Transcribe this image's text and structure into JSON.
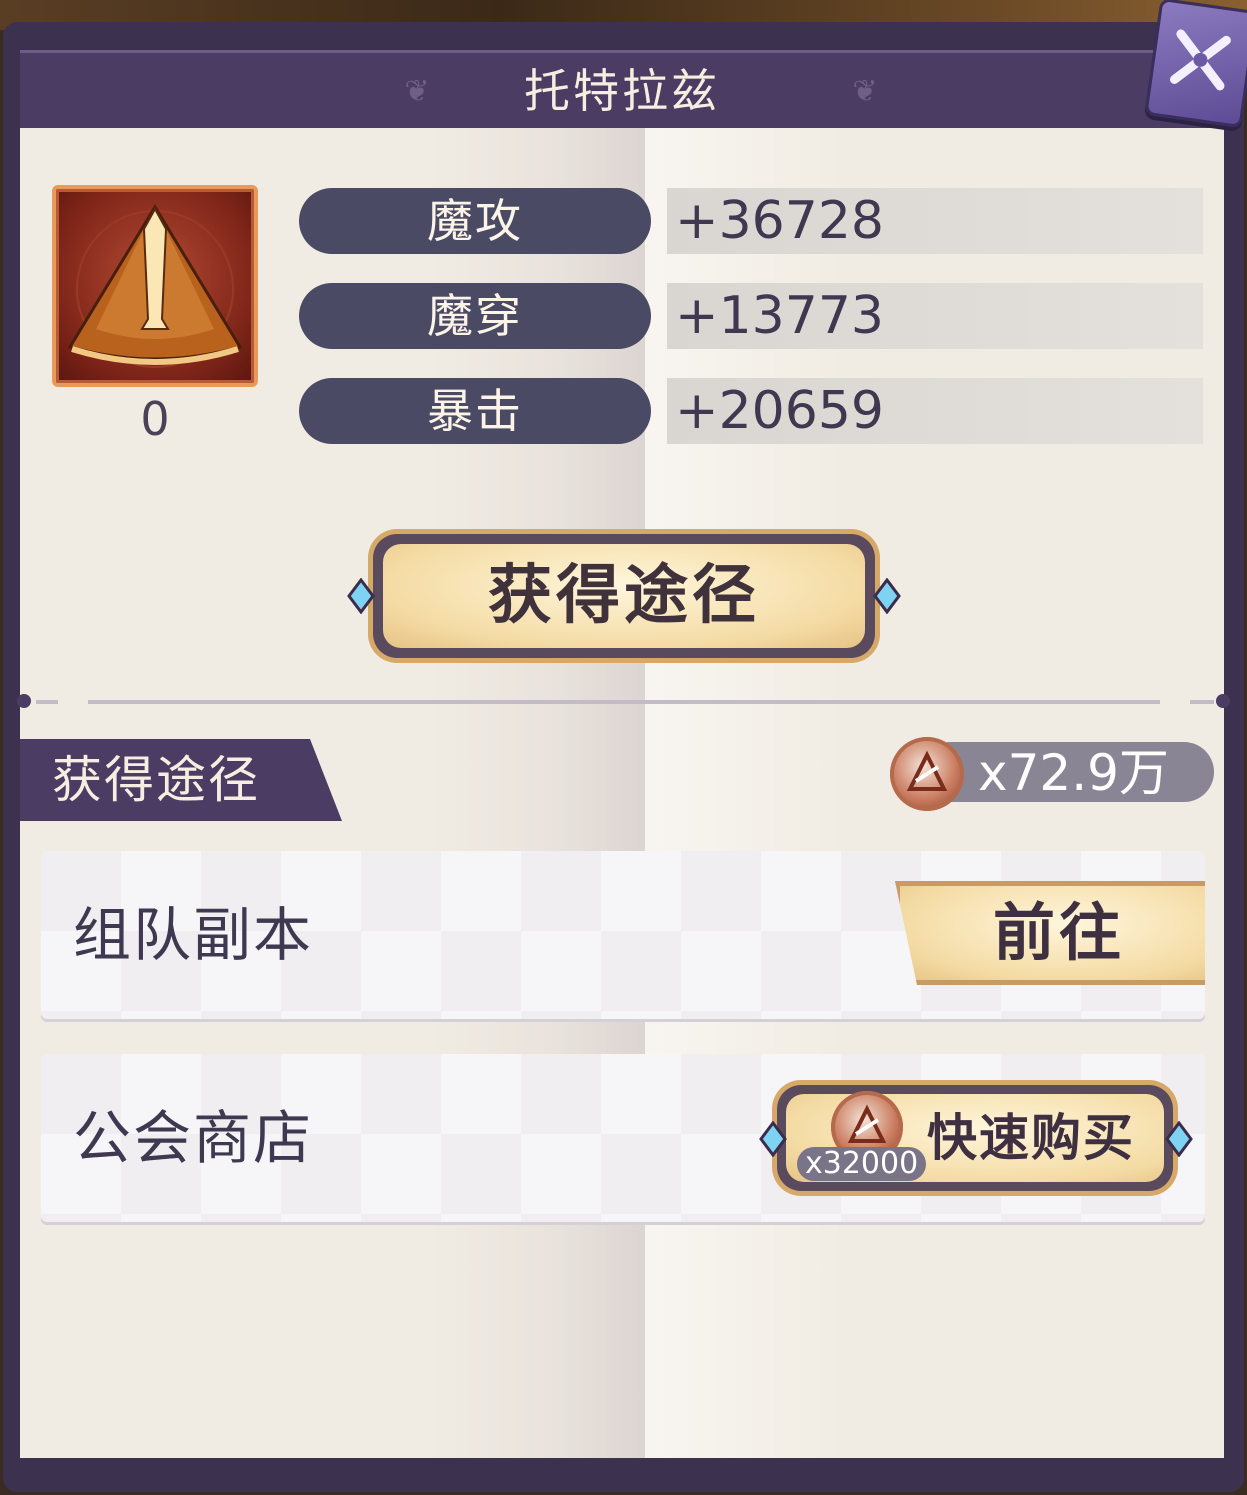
{
  "header": {
    "title": "托特拉兹"
  },
  "item": {
    "icon": "triangle-relic-icon",
    "count": "0",
    "colors": {
      "frame": "#e89a5a",
      "bg": "#7d2418"
    }
  },
  "stats": [
    {
      "label": "魔攻",
      "value": "+36728"
    },
    {
      "label": "魔穿",
      "value": "+13773"
    },
    {
      "label": "暴击",
      "value": "+20659"
    }
  ],
  "obtain_button": {
    "label": "获得途径"
  },
  "sources_section": {
    "title": "获得途径",
    "currency": {
      "icon": "guild-coin-icon",
      "amount": "x72.9万"
    }
  },
  "sources": [
    {
      "label": "组队副本",
      "action": "前往"
    },
    {
      "label": "公会商店",
      "action": "快速购买",
      "cost": "x32000"
    }
  ],
  "colors": {
    "header": "#4a3c63",
    "panel": "#f1ece3",
    "stat_label": "#4a4a65",
    "accent_gold": "#d6a968"
  }
}
